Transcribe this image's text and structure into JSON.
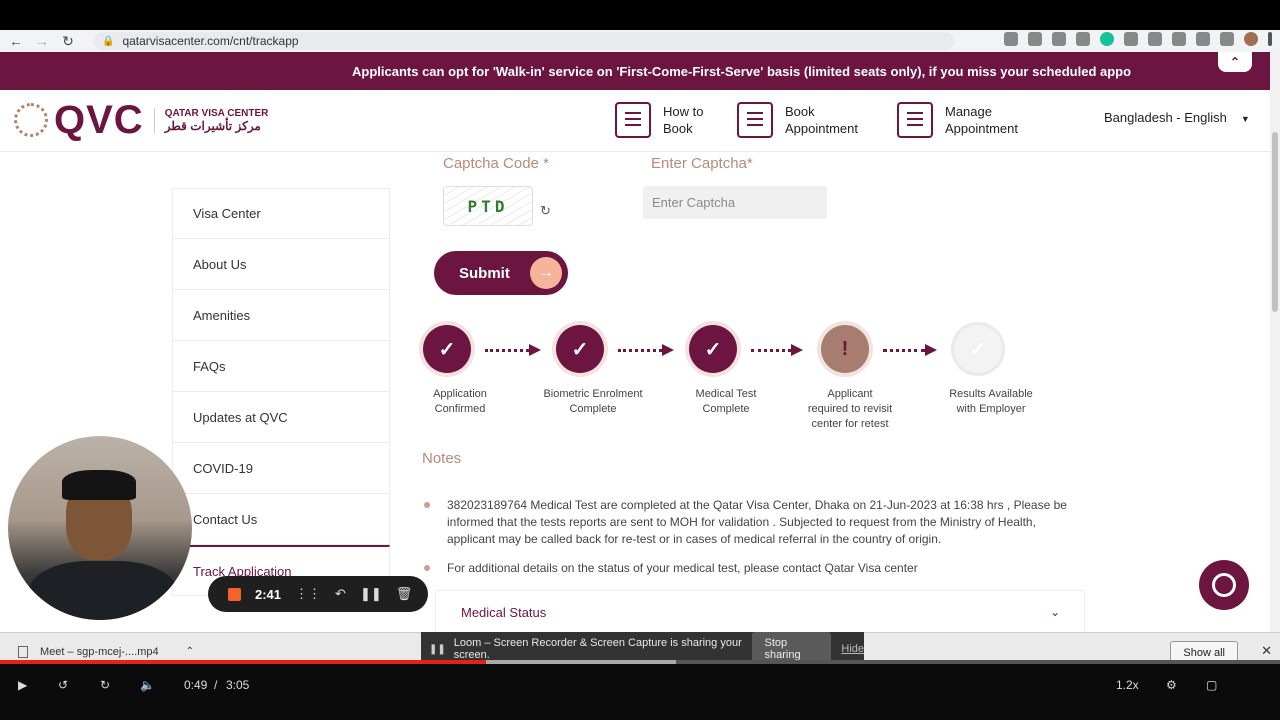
{
  "browser": {
    "url": "qatarvisacenter.com/cnt/trackapp"
  },
  "site": {
    "banner_text": "Applicants can opt for 'Walk-in' service on 'First-Come-First-Serve' basis (limited seats only), if you miss your scheduled appo",
    "logo": {
      "text": "QVC",
      "sub_en": "QATAR VISA CENTER",
      "sub_ar": "مركز تأشيرات قطر"
    },
    "menu": [
      {
        "line1": "How to",
        "line2": "Book"
      },
      {
        "line1": "Book",
        "line2": "Appointment"
      },
      {
        "line1": "Manage",
        "line2": "Appointment"
      }
    ],
    "language": "Bangladesh - English",
    "sidebar": [
      {
        "label": "Visa Center"
      },
      {
        "label": "About Us"
      },
      {
        "label": "Amenities"
      },
      {
        "label": "FAQs"
      },
      {
        "label": "Updates at QVC"
      },
      {
        "label": "COVID-19"
      },
      {
        "label": "Contact Us"
      },
      {
        "label": "Track Application"
      }
    ],
    "form": {
      "captcha_label": "Captcha Code *",
      "captcha_text": "PTD",
      "enter_captcha_label": "Enter Captcha*",
      "captcha_placeholder": "Enter Captcha",
      "submit_label": "Submit"
    },
    "steps": [
      {
        "line1": "Application",
        "line2": "Confirmed",
        "line3": "",
        "status": "done"
      },
      {
        "line1": "Biometric Enrolment",
        "line2": "Complete",
        "line3": "",
        "status": "done"
      },
      {
        "line1": "Medical Test",
        "line2": "Complete",
        "line3": "",
        "status": "done"
      },
      {
        "line1": "Applicant",
        "line2": "required to revisit",
        "line3": "center for retest",
        "status": "warning"
      },
      {
        "line1": "Results Available",
        "line2": "with Employer",
        "line3": "",
        "status": "pending"
      }
    ],
    "notes_title": "Notes",
    "notes": [
      "382023189764 Medical Test are completed at the Qatar Visa Center, Dhaka on 21-Jun-2023 at 16:38 hrs , Please be informed that the tests reports are sent to MOH for validation . Subjected to request from the Ministry of Health, applicant may be called back for re-test or in cases of medical referral in the country of origin.",
      "For additional details on the status of your medical test, please contact Qatar Visa center"
    ],
    "accordion_label": "Medical Status"
  },
  "recorder": {
    "time": "2:41"
  },
  "downloads": {
    "file_name": "Meet – sgp-mcej-....mp4",
    "show_all": "Show all"
  },
  "loom": {
    "message": "Loom – Screen Recorder & Screen Capture is sharing your screen.",
    "stop_label": "Stop sharing",
    "hide_label": "Hide"
  },
  "player": {
    "current_time": "0:49",
    "duration": "3:05",
    "speed": "1.2x",
    "progress_fraction": 0.38
  },
  "colors": {
    "brand": "#6b1540",
    "accent": "#b78b78",
    "warning": "#a77d6f"
  }
}
